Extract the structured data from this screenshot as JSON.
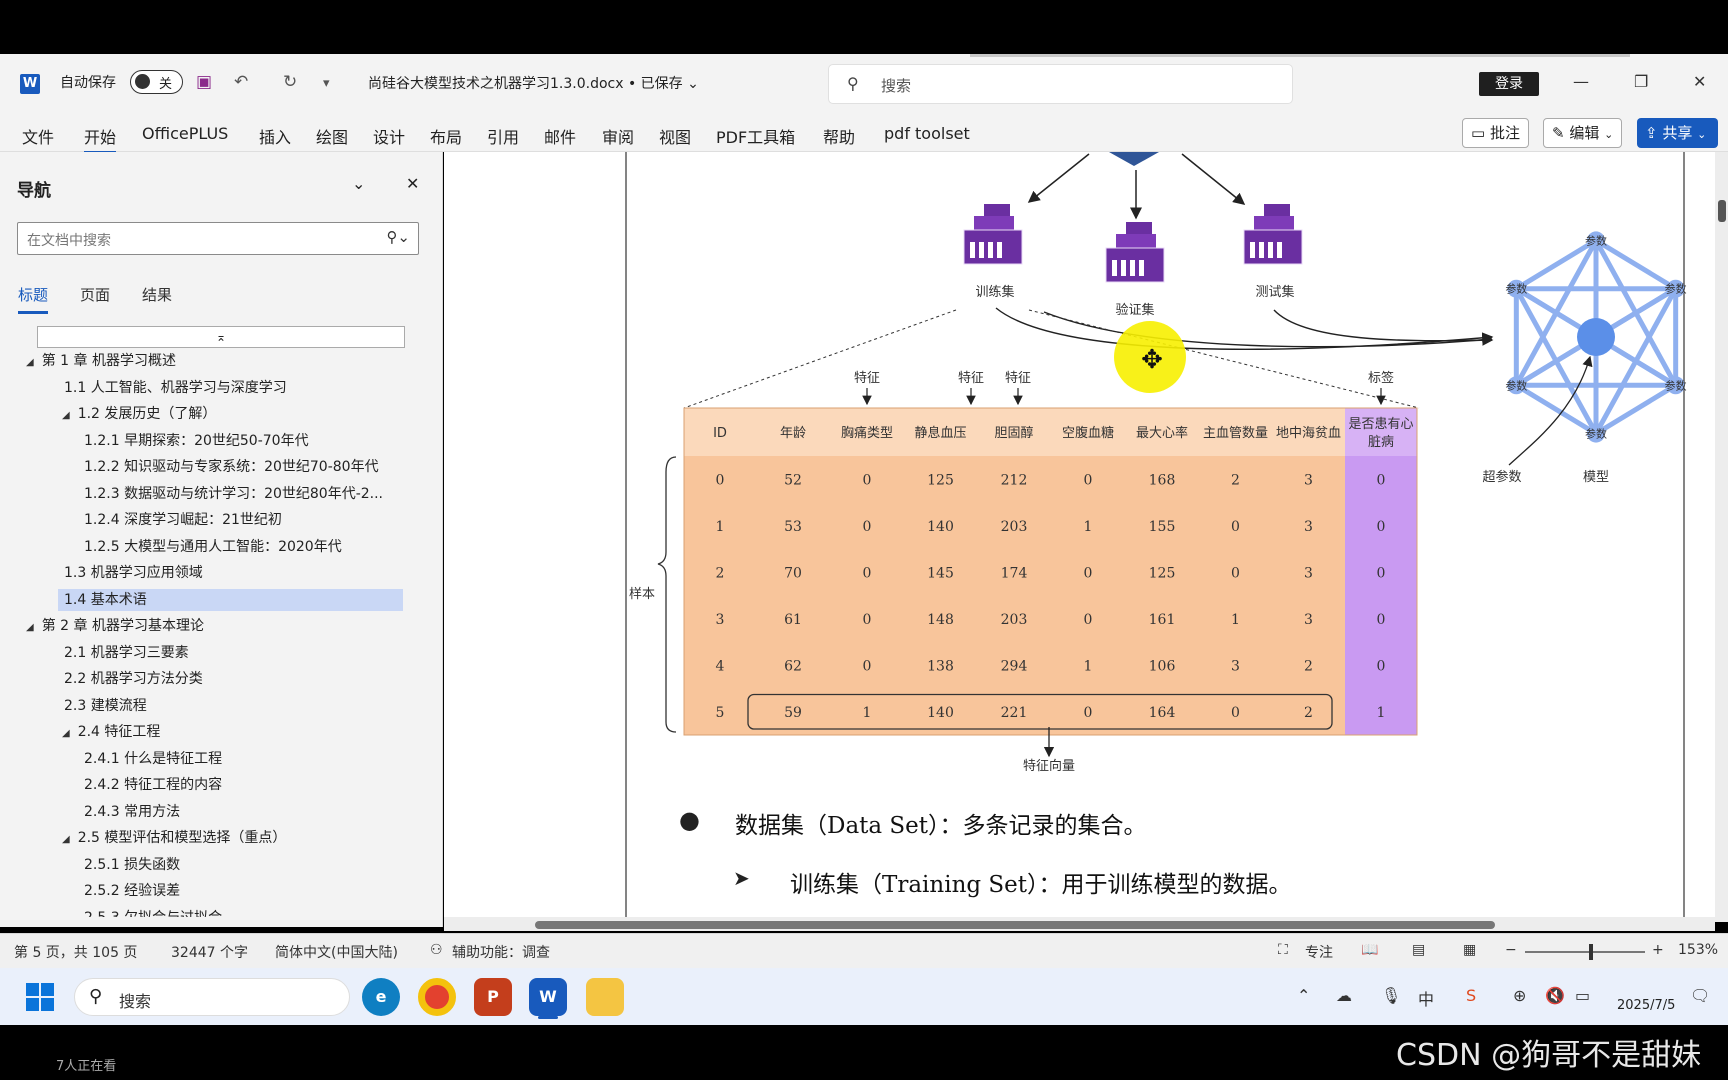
{
  "titlebar": {
    "autosave_label": "自动保存",
    "toggle_state": "关",
    "doc_title": "尚硅谷大模型技术之机器学习1.3.0.docx • 已保存 ⌄",
    "search_placeholder": "搜索",
    "login_label": "登录"
  },
  "ribbon": {
    "menus": [
      "文件",
      "开始",
      "OfficePLUS",
      "插入",
      "绘图",
      "设计",
      "布局",
      "引用",
      "邮件",
      "审阅",
      "视图",
      "PDF工具箱",
      "帮助",
      "pdf toolset"
    ],
    "comment_label": "批注",
    "edit_label": "编辑",
    "share_label": "共享"
  },
  "nav": {
    "title": "导航",
    "search_placeholder": "在文档中搜索",
    "tabs": [
      "标题",
      "页面",
      "结果"
    ],
    "items": [
      {
        "label": "第 1 章 机器学习概述",
        "level": 0,
        "arrow": "◢"
      },
      {
        "label": "1.1 人工智能、机器学习与深度学习",
        "level": 1,
        "arrow": ""
      },
      {
        "label": "1.2 发展历史（了解）",
        "level": 1,
        "arrow": "◢"
      },
      {
        "label": "1.2.1 早期探索：20世纪50-70年代",
        "level": 2,
        "arrow": ""
      },
      {
        "label": "1.2.2 知识驱动与专家系统：20世纪70-80年代",
        "level": 2,
        "arrow": ""
      },
      {
        "label": "1.2.3 数据驱动与统计学习：20世纪80年代-2...",
        "level": 2,
        "arrow": ""
      },
      {
        "label": "1.2.4 深度学习崛起：21世纪初",
        "level": 2,
        "arrow": ""
      },
      {
        "label": "1.2.5 大模型与通用人工智能：2020年代",
        "level": 2,
        "arrow": ""
      },
      {
        "label": "1.3 机器学习应用领域",
        "level": 1,
        "arrow": ""
      },
      {
        "label": "1.4 基本术语",
        "level": 1,
        "arrow": "",
        "selected": true
      },
      {
        "label": "第 2 章 机器学习基本理论",
        "level": 0,
        "arrow": "◢"
      },
      {
        "label": "2.1 机器学习三要素",
        "level": 1,
        "arrow": ""
      },
      {
        "label": "2.2 机器学习方法分类",
        "level": 1,
        "arrow": ""
      },
      {
        "label": "2.3 建模流程",
        "level": 1,
        "arrow": ""
      },
      {
        "label": "2.4 特征工程",
        "level": 1,
        "arrow": "◢"
      },
      {
        "label": "2.4.1 什么是特征工程",
        "level": 2,
        "arrow": ""
      },
      {
        "label": "2.4.2 特征工程的内容",
        "level": 2,
        "arrow": ""
      },
      {
        "label": "2.4.3 常用方法",
        "level": 2,
        "arrow": ""
      },
      {
        "label": "2.5 模型评估和模型选择（重点）",
        "level": 1,
        "arrow": "◢"
      },
      {
        "label": "2.5.1 损失函数",
        "level": 2,
        "arrow": ""
      },
      {
        "label": "2.5.2 经验误差",
        "level": 2,
        "arrow": ""
      },
      {
        "label": "2.5.3 欠拟合与过拟合",
        "level": 2,
        "arrow": ""
      }
    ]
  },
  "figure": {
    "datasets": [
      "训练集",
      "验证集",
      "测试集"
    ],
    "feature_tag": "特征",
    "label_tag": "标签",
    "columns": [
      "ID",
      "年龄",
      "胸痛类型",
      "静息血压",
      "胆固醇",
      "空腹血糖",
      "最大心率",
      "主血管数量",
      "地中海贫血",
      "是否患有心脏病"
    ],
    "rows": [
      [
        "0",
        "52",
        "0",
        "125",
        "212",
        "0",
        "168",
        "2",
        "3",
        "0"
      ],
      [
        "1",
        "53",
        "0",
        "140",
        "203",
        "1",
        "155",
        "0",
        "3",
        "0"
      ],
      [
        "2",
        "70",
        "0",
        "145",
        "174",
        "0",
        "125",
        "0",
        "3",
        "0"
      ],
      [
        "3",
        "61",
        "0",
        "148",
        "203",
        "0",
        "161",
        "1",
        "3",
        "0"
      ],
      [
        "4",
        "62",
        "0",
        "138",
        "294",
        "1",
        "106",
        "3",
        "2",
        "0"
      ],
      [
        "5",
        "59",
        "1",
        "140",
        "221",
        "0",
        "164",
        "0",
        "2",
        "1"
      ]
    ],
    "sample_label": "样本",
    "feature_vector_label": "特征向量",
    "param_label": "参数",
    "hyperparam_label": "超参数",
    "model_label": "模型",
    "colors": {
      "table_orange": "#f8c59b",
      "header_orange": "#fbd9bb",
      "label_purple": "#c99af2",
      "network_blue": "#8fb0ef",
      "node_blue": "#5b8fe8",
      "icon_purple": "#6a2fa1"
    }
  },
  "body": {
    "bullet1": "数据集（Data Set）：多条记录的集合。",
    "bullet2": "训练集（Training Set）：用于训练模型的数据。"
  },
  "statusbar": {
    "page": "第 5 页，共 105 页",
    "words": "32447 个字",
    "lang": "简体中文(中国大陆)",
    "access": "辅助功能：调查",
    "focus": "专注",
    "zoom": "153%"
  },
  "taskbar": {
    "search": "搜索",
    "date": "2025/7/5"
  },
  "overlay": {
    "viewers": "7人正在看",
    "watermark": "CSDN @狗哥不是甜妹"
  }
}
